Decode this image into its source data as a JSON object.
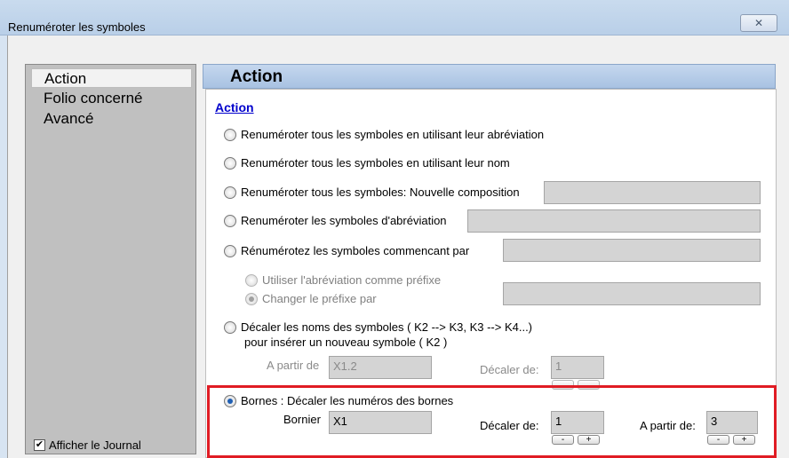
{
  "window": {
    "title": "Renuméroter les symboles",
    "close_glyph": "✕"
  },
  "sidebar": {
    "items": [
      {
        "label": "Action"
      },
      {
        "label": "Folio concerné"
      },
      {
        "label": "Avancé"
      }
    ]
  },
  "journal": {
    "label": "Afficher le Journal",
    "checked_glyph": "✔"
  },
  "header": {
    "title": "Action"
  },
  "section": {
    "title": "Action"
  },
  "options": {
    "abbr": "Renuméroter tous les symboles en utilisant leur abréviation",
    "name": "Renuméroter tous les symboles en utilisant leur nom",
    "composition": "Renuméroter tous les symboles: Nouvelle composition",
    "abbr_symbols": "Renuméroter les symboles d'abréviation",
    "starting": "Rénumérotez les symboles commencant par",
    "use_abbr_prefix": "Utiliser l'abréviation comme préfixe",
    "change_prefix": "Changer le préfixe par",
    "shift_names": "Décaler les noms des symboles ( K2 --> K3, K3 --> K4...)",
    "shift_names_2": "pour insérer un nouveau symbole ( K2 )",
    "bornes": "Bornes : Décaler les numéros des bornes"
  },
  "shift": {
    "from_label": "A partir de",
    "from_value": "X1.2",
    "offset_label": "Décaler de:",
    "offset_value": "1"
  },
  "bornes": {
    "bornier_label": "Bornier",
    "bornier_value": "X1",
    "offset_label": "Décaler de:",
    "offset_value": "1",
    "from_label": "A partir de:",
    "from_value": "3",
    "minus": "-",
    "plus": "+"
  }
}
